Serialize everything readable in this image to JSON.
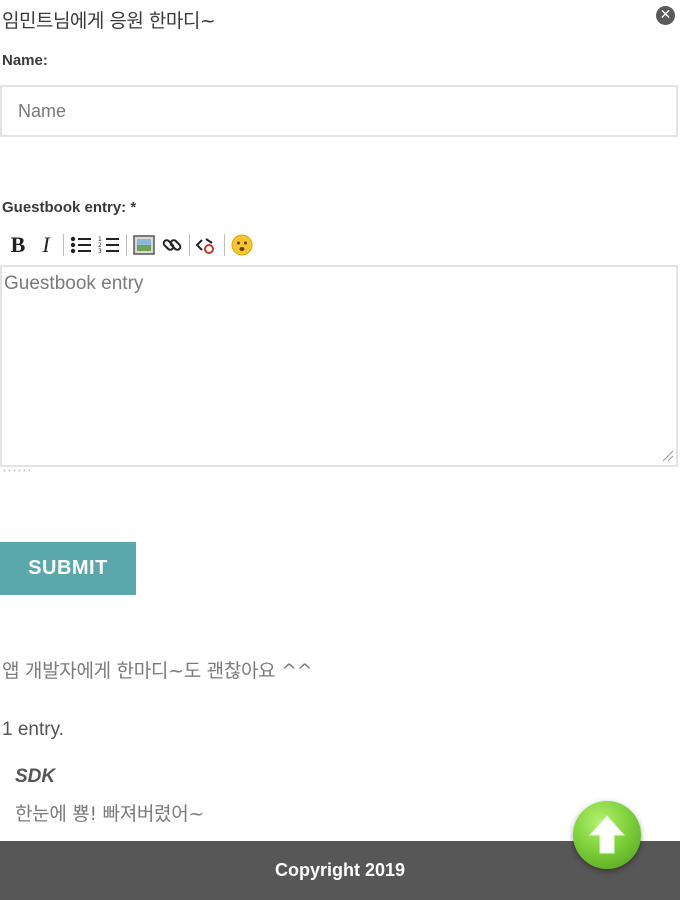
{
  "header": {
    "title": "임민트님에게 응원 한마디~",
    "close_icon": "close-icon"
  },
  "form": {
    "name_label": "Name:",
    "name_placeholder": "Name",
    "entry_label": "Guestbook entry: *",
    "entry_placeholder": "Guestbook entry",
    "submit_label": "SUBMIT",
    "toolbar": [
      {
        "name": "bold-button",
        "icon": "bold-icon",
        "glyph": "B"
      },
      {
        "name": "italic-button",
        "icon": "italic-icon",
        "glyph": "I"
      },
      {
        "name": "bulleted-list-button",
        "icon": "bulleted-list-icon"
      },
      {
        "name": "numbered-list-button",
        "icon": "numbered-list-icon"
      },
      {
        "name": "insert-image-button",
        "icon": "image-icon"
      },
      {
        "name": "insert-link-button",
        "icon": "link-icon"
      },
      {
        "name": "insert-code-button",
        "icon": "code-icon"
      },
      {
        "name": "insert-emoji-button",
        "icon": "emoji-icon"
      }
    ]
  },
  "guestbook": {
    "note": "앱 개발자에게 한마디~도 괜찮아요 ^^",
    "count_text": "1 entry.",
    "entries": [
      {
        "author": "SDK",
        "text": "한눈에 뿅! 빠져버렸어~"
      }
    ]
  },
  "footer": {
    "copyright": "Copyright 2019"
  },
  "scroll_top": {
    "icon": "arrow-up-icon"
  },
  "colors": {
    "accent": "#5aa8ab",
    "footer_bg": "#575757",
    "scroll_top": "#7ed23a"
  }
}
